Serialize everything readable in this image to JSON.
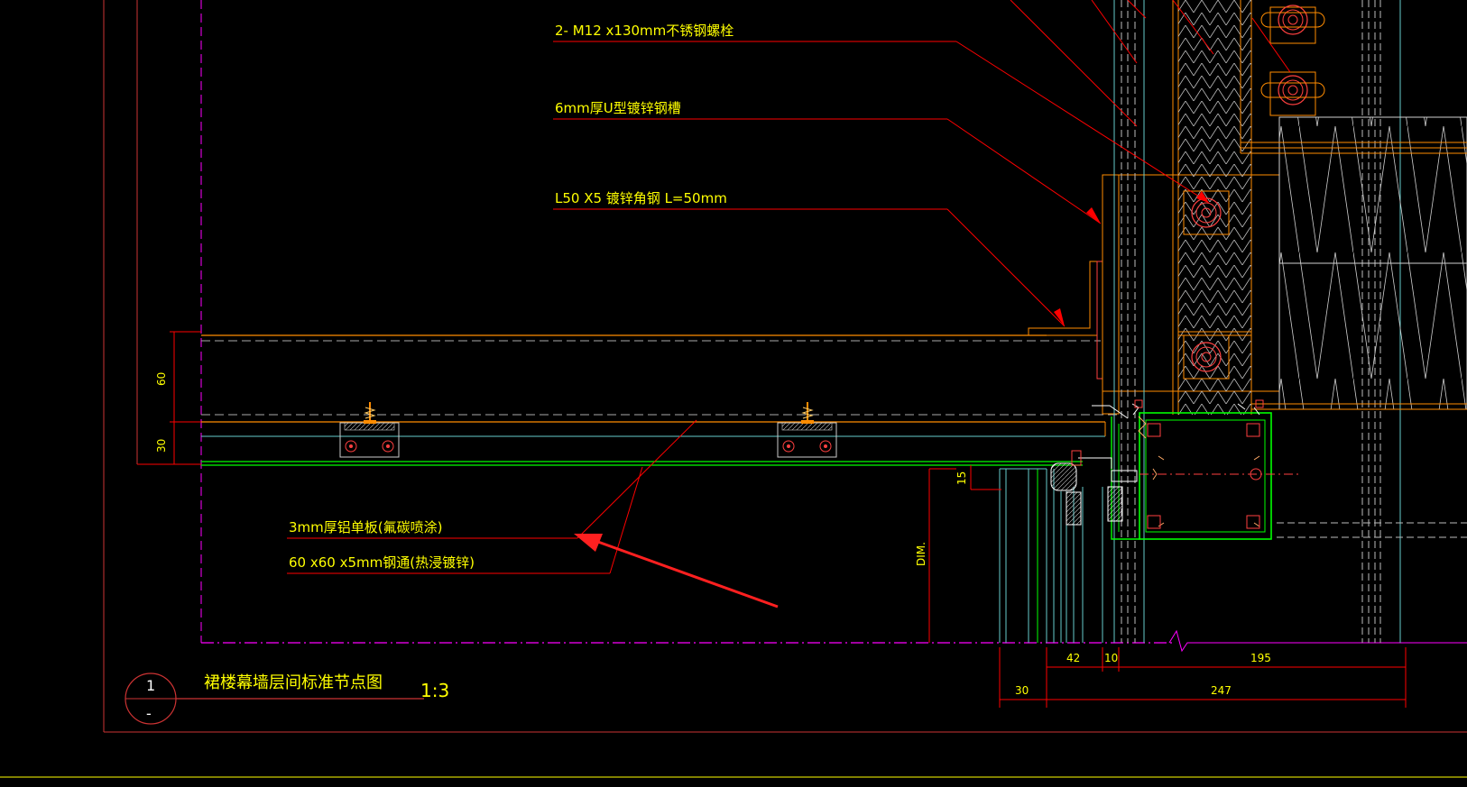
{
  "drawing": {
    "title": "裙楼幕墙层间标准节点图",
    "scale": "1:3",
    "detail_number": "1",
    "detail_sheet": "-"
  },
  "annotations": {
    "bolt": "2- M12 x130mm不锈钢螺栓",
    "channel": "6mm厚U型镀锌钢槽",
    "angle": "L50 X5 镀锌角钢  L=50mm",
    "panel": "3mm厚铝单板(氟碳喷涂)",
    "tube": "60 x60 x5mm钢通(热浸镀锌)"
  },
  "dimensions": {
    "v60": "60",
    "v30": "30",
    "v15": "15",
    "dim_label": "DIM.",
    "h42": "42",
    "h10": "10",
    "h195": "195",
    "h30": "30",
    "h247": "247"
  },
  "colors": {
    "background": "#000000",
    "annotation_text": "#ffff00",
    "leader": "#ff0000",
    "orange": "#ff8c00",
    "green": "#00ff00",
    "cyan": "#66cccc",
    "magenta": "#ff00ff",
    "white": "#ffffff",
    "arrow": "#ff2020"
  }
}
